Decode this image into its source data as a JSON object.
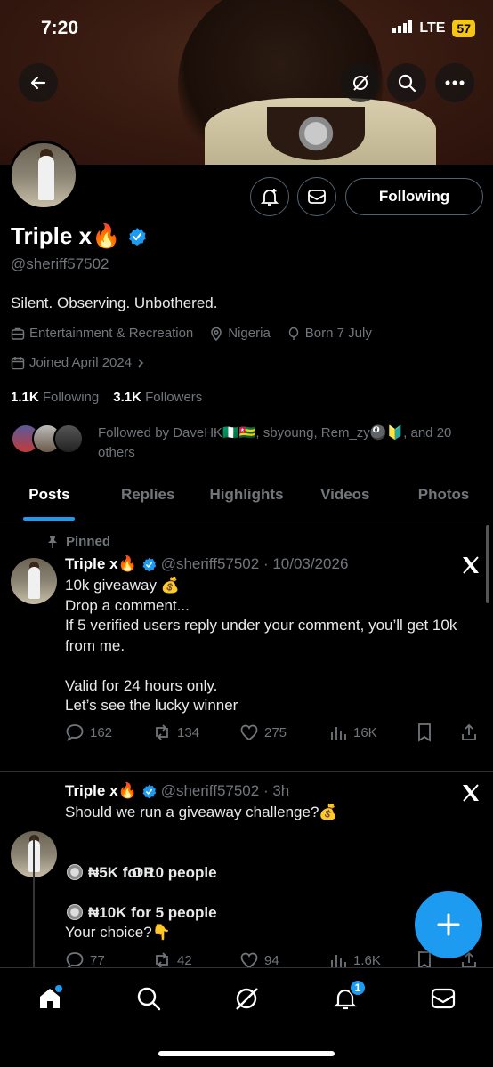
{
  "status_bar": {
    "time": "7:20",
    "network": "LTE",
    "battery": "57"
  },
  "profile": {
    "name": "Triple x",
    "name_emoji": "🔥",
    "handle": "@sheriff57502",
    "bio": "Silent. Observing. Unbothered.",
    "category": "Entertainment & Recreation",
    "location": "Nigeria",
    "born": "Born 7 July",
    "joined": "Joined April 2024",
    "following_count": "1.1K",
    "following_label": "Following",
    "followers_count": "3.1K",
    "followers_label": "Followers",
    "followed_by_line1": "Followed by DaveHK🇳🇬🇹🇬, sbyoung, Rem_zy🎱🔰, and 20",
    "followed_by_line2": "others",
    "follow_button": "Following"
  },
  "tabs": [
    "Posts",
    "Replies",
    "Highlights",
    "Videos",
    "Photos"
  ],
  "posts": [
    {
      "pinned_label": "Pinned",
      "author": "Triple x🔥",
      "handle_time": "@sheriff57502 · 10/03/2026",
      "text": "10k giveaway 💰\nDrop a comment...\nIf 5 verified users reply under your comment, you’ll get 10k from me.\n\nValid for 24 hours only.\nLet’s see the lucky winner",
      "replies": "162",
      "reposts": "134",
      "likes": "275",
      "views": "16K"
    },
    {
      "author": "Triple x🔥",
      "handle_time": "@sheriff57502 · 3h",
      "text_line1": "Should we run a giveaway challenge?💰",
      "option1": "₦5K for 10 people",
      "or_label": "OR",
      "option2": "₦10K for 5 people",
      "text_line2": "Your choice?👇",
      "replies": "77",
      "reposts": "42",
      "likes": "94",
      "views": "1.6K"
    }
  ],
  "nav": {
    "notification_badge": "1"
  },
  "colors": {
    "accent": "#1d9bf0",
    "background": "#000000",
    "muted": "#71767b",
    "battery": "#f5c518"
  }
}
